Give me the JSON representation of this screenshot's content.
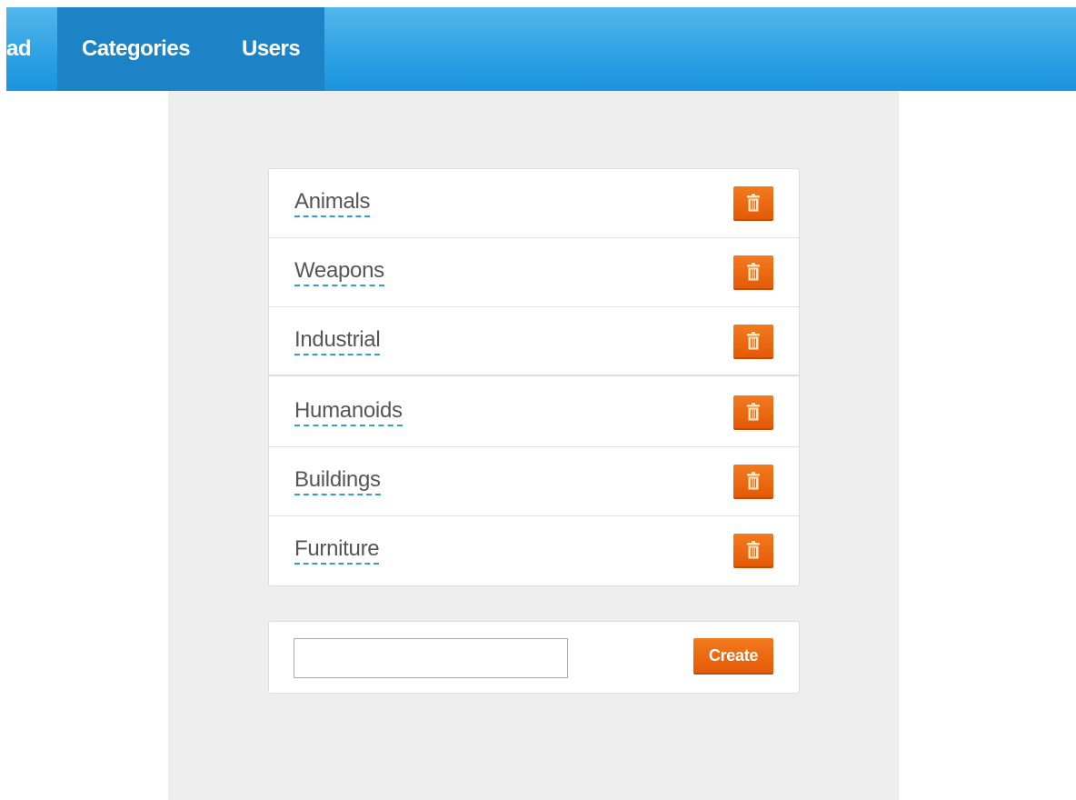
{
  "nav": {
    "items": [
      {
        "label": "ad"
      },
      {
        "label": "Categories"
      },
      {
        "label": "Users"
      }
    ],
    "active": "Categories",
    "colors": {
      "bar": "#2fa2e4",
      "active": "#1c84c6"
    }
  },
  "categories": {
    "items": [
      {
        "label": "Animals",
        "action_icon": "trash-icon"
      },
      {
        "label": "Weapons",
        "action_icon": "trash-icon"
      },
      {
        "label": "Industrial",
        "action_icon": "trash-icon"
      },
      {
        "label": "Humanoids",
        "action_icon": "trash-icon"
      },
      {
        "label": "Buildings",
        "action_icon": "trash-icon"
      },
      {
        "label": "Furniture",
        "action_icon": "trash-icon"
      }
    ],
    "colors": {
      "delete_button": "#e8600b",
      "link_underline": "#2f9fd6"
    }
  },
  "create_form": {
    "input_value": "",
    "input_placeholder": "",
    "button_label": "Create"
  }
}
